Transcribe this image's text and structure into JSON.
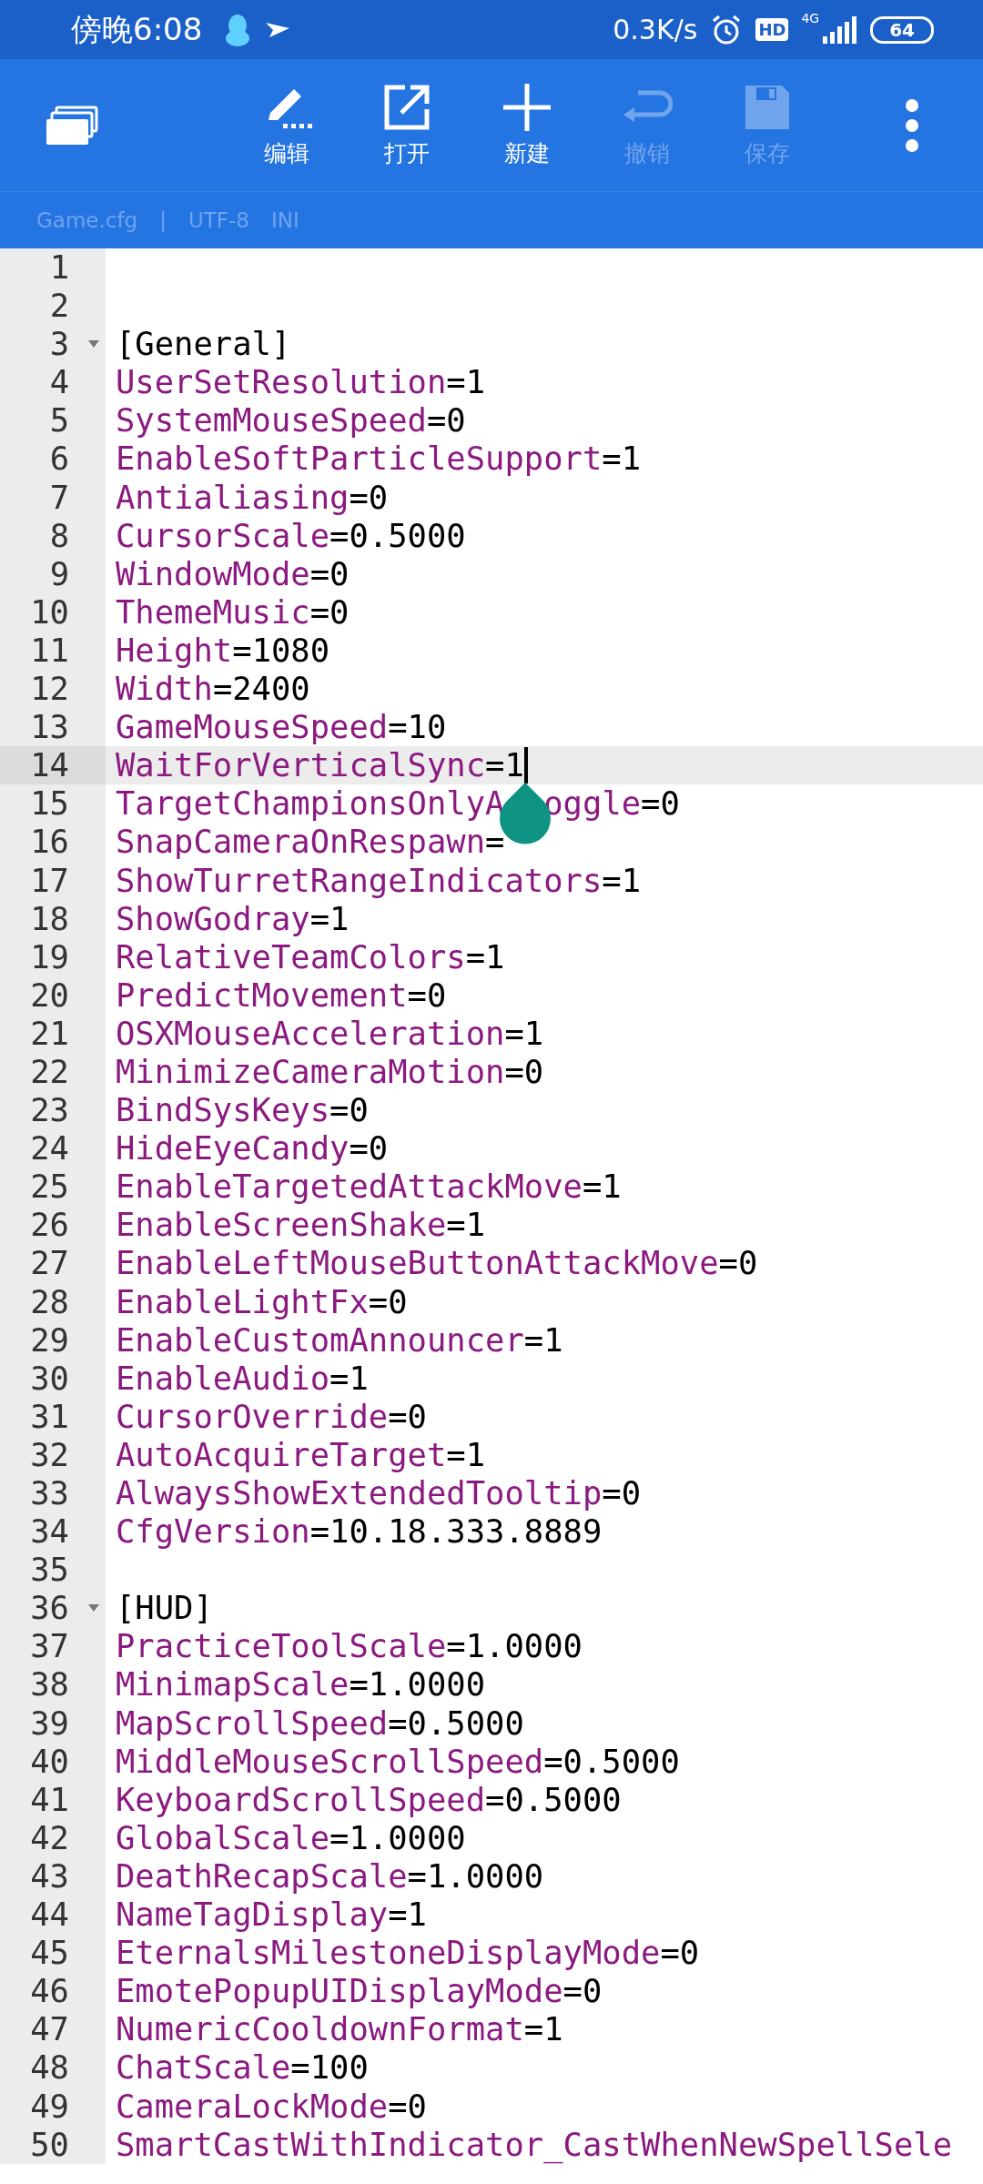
{
  "status_bar": {
    "time": "傍晚6:08",
    "net_speed": "0.3K/s",
    "hd": "HD",
    "network": "4G",
    "battery": "64"
  },
  "toolbar": {
    "buttons": [
      {
        "kind": "edit",
        "label": "编辑",
        "disabled": false
      },
      {
        "kind": "open",
        "label": "打开",
        "disabled": false
      },
      {
        "kind": "new",
        "label": "新建",
        "disabled": false
      },
      {
        "kind": "undo",
        "label": "撤销",
        "disabled": true
      },
      {
        "kind": "save",
        "label": "保存",
        "disabled": true
      }
    ]
  },
  "file_info": {
    "name": "Game.cfg",
    "separator": "|",
    "encoding": "UTF-8",
    "syntax": "INI"
  },
  "editor": {
    "assign": "=",
    "lines": [
      {
        "number": "1",
        "kind": "blank",
        "current": false
      },
      {
        "number": "2",
        "kind": "blank",
        "current": false
      },
      {
        "number": "3",
        "kind": "section",
        "text": "[General]",
        "expanded": true,
        "current": false
      },
      {
        "number": "4",
        "kind": "entry",
        "key": "UserSetResolution",
        "value": "1",
        "current": false
      },
      {
        "number": "5",
        "kind": "entry",
        "key": "SystemMouseSpeed",
        "value": "0",
        "current": false
      },
      {
        "number": "6",
        "kind": "entry",
        "key": "EnableSoftParticleSupport",
        "value": "1",
        "current": false
      },
      {
        "number": "7",
        "kind": "entry",
        "key": "Antialiasing",
        "value": "0",
        "current": false
      },
      {
        "number": "8",
        "kind": "entry",
        "key": "CursorScale",
        "value": "0.5000",
        "current": false
      },
      {
        "number": "9",
        "kind": "entry",
        "key": "WindowMode",
        "value": "0",
        "current": false
      },
      {
        "number": "10",
        "kind": "entry",
        "key": "ThemeMusic",
        "value": "0",
        "current": false
      },
      {
        "number": "11",
        "kind": "entry",
        "key": "Height",
        "value": "1080",
        "current": false
      },
      {
        "number": "12",
        "kind": "entry",
        "key": "Width",
        "value": "2400",
        "current": false
      },
      {
        "number": "13",
        "kind": "entry",
        "key": "GameMouseSpeed",
        "value": "10",
        "current": false
      },
      {
        "number": "14",
        "kind": "entry",
        "key": "WaitForVerticalSync",
        "value": "1",
        "current": true
      },
      {
        "number": "15",
        "kind": "entry_covered",
        "key_head": "TargetChampionsOnlyA",
        "key_tail": "oggle",
        "value": "0",
        "current": false
      },
      {
        "number": "16",
        "kind": "entry",
        "key": "SnapCameraOnRespawn",
        "value_hidden": true,
        "current": false
      },
      {
        "number": "17",
        "kind": "entry",
        "key": "ShowTurretRangeIndicators",
        "value": "1",
        "current": false
      },
      {
        "number": "18",
        "kind": "entry",
        "key": "ShowGodray",
        "value": "1",
        "current": false
      },
      {
        "number": "19",
        "kind": "entry",
        "key": "RelativeTeamColors",
        "value": "1",
        "current": false
      },
      {
        "number": "20",
        "kind": "entry",
        "key": "PredictMovement",
        "value": "0",
        "current": false
      },
      {
        "number": "21",
        "kind": "entry",
        "key": "OSXMouseAcceleration",
        "value": "1",
        "current": false
      },
      {
        "number": "22",
        "kind": "entry",
        "key": "MinimizeCameraMotion",
        "value": "0",
        "current": false
      },
      {
        "number": "23",
        "kind": "entry",
        "key": "BindSysKeys",
        "value": "0",
        "current": false
      },
      {
        "number": "24",
        "kind": "entry",
        "key": "HideEyeCandy",
        "value": "0",
        "current": false
      },
      {
        "number": "25",
        "kind": "entry",
        "key": "EnableTargetedAttackMove",
        "value": "1",
        "current": false
      },
      {
        "number": "26",
        "kind": "entry",
        "key": "EnableScreenShake",
        "value": "1",
        "current": false
      },
      {
        "number": "27",
        "kind": "entry",
        "key": "EnableLeftMouseButtonAttackMove",
        "value": "0",
        "current": false
      },
      {
        "number": "28",
        "kind": "entry",
        "key": "EnableLightFx",
        "value": "0",
        "current": false
      },
      {
        "number": "29",
        "kind": "entry",
        "key": "EnableCustomAnnouncer",
        "value": "1",
        "current": false
      },
      {
        "number": "30",
        "kind": "entry",
        "key": "EnableAudio",
        "value": "1",
        "current": false
      },
      {
        "number": "31",
        "kind": "entry",
        "key": "CursorOverride",
        "value": "0",
        "current": false
      },
      {
        "number": "32",
        "kind": "entry",
        "key": "AutoAcquireTarget",
        "value": "1",
        "current": false
      },
      {
        "number": "33",
        "kind": "entry",
        "key": "AlwaysShowExtendedTooltip",
        "value": "0",
        "current": false
      },
      {
        "number": "34",
        "kind": "entry",
        "key": "CfgVersion",
        "value": "10.18.333.8889",
        "current": false
      },
      {
        "number": "35",
        "kind": "blank",
        "current": false
      },
      {
        "number": "36",
        "kind": "section",
        "text": "[HUD]",
        "expanded": true,
        "current": false
      },
      {
        "number": "37",
        "kind": "entry",
        "key": "PracticeToolScale",
        "value": "1.0000",
        "current": false
      },
      {
        "number": "38",
        "kind": "entry",
        "key": "MinimapScale",
        "value": "1.0000",
        "current": false
      },
      {
        "number": "39",
        "kind": "entry",
        "key": "MapScrollSpeed",
        "value": "0.5000",
        "current": false
      },
      {
        "number": "40",
        "kind": "entry",
        "key": "MiddleMouseScrollSpeed",
        "value": "0.5000",
        "current": false
      },
      {
        "number": "41",
        "kind": "entry",
        "key": "KeyboardScrollSpeed",
        "value": "0.5000",
        "current": false
      },
      {
        "number": "42",
        "kind": "entry",
        "key": "GlobalScale",
        "value": "1.0000",
        "current": false
      },
      {
        "number": "43",
        "kind": "entry",
        "key": "DeathRecapScale",
        "value": "1.0000",
        "current": false
      },
      {
        "number": "44",
        "kind": "entry",
        "key": "NameTagDisplay",
        "value": "1",
        "current": false
      },
      {
        "number": "45",
        "kind": "entry",
        "key": "EternalsMilestoneDisplayMode",
        "value": "0",
        "current": false
      },
      {
        "number": "46",
        "kind": "entry",
        "key": "EmotePopupUIDisplayMode",
        "value": "0",
        "current": false
      },
      {
        "number": "47",
        "kind": "entry",
        "key": "NumericCooldownFormat",
        "value": "1",
        "current": false
      },
      {
        "number": "48",
        "kind": "entry",
        "key": "ChatScale",
        "value": "100",
        "current": false
      },
      {
        "number": "49",
        "kind": "entry",
        "key": "CameraLockMode",
        "value": "0",
        "current": false
      },
      {
        "number": "50",
        "kind": "entry",
        "key": "SmartCastWithIndicator_CastWhenNewSpellSele",
        "current": false
      }
    ]
  }
}
